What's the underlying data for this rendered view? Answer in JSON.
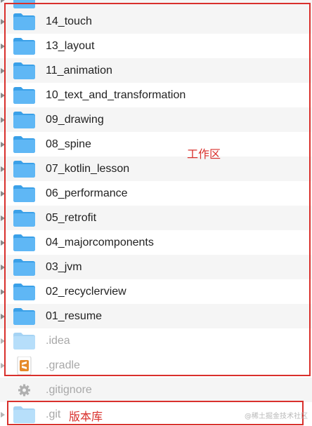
{
  "folders": [
    {
      "name": "14_touch",
      "dim": false
    },
    {
      "name": "13_layout",
      "dim": false
    },
    {
      "name": "11_animation",
      "dim": false
    },
    {
      "name": "10_text_and_transformation",
      "dim": false
    },
    {
      "name": "09_drawing",
      "dim": false
    },
    {
      "name": "08_spine",
      "dim": false
    },
    {
      "name": "07_kotlin_lesson",
      "dim": false
    },
    {
      "name": "06_performance",
      "dim": false
    },
    {
      "name": "05_retrofit",
      "dim": false
    },
    {
      "name": "04_majorcomponents",
      "dim": false
    },
    {
      "name": "03_jvm",
      "dim": false
    },
    {
      "name": "02_recyclerview",
      "dim": false
    },
    {
      "name": "01_resume",
      "dim": false
    },
    {
      "name": ".idea",
      "dim": true
    }
  ],
  "files": {
    "gradle": ".gradle",
    "gitignore": ".gitignore",
    "git": ".git"
  },
  "icons": {
    "folder": "folder-icon",
    "gradle": "sublime-file-icon",
    "gitignore": "gear-icon"
  },
  "annotations": {
    "workspace": "工作区",
    "repository": "版本库"
  },
  "watermark": "@稀土掘金技术社区",
  "colors": {
    "folder_front": "#5fb7f5",
    "folder_back": "#3aa0e8",
    "annotation_red": "#d9302c",
    "row_alt": "#f5f5f5"
  }
}
